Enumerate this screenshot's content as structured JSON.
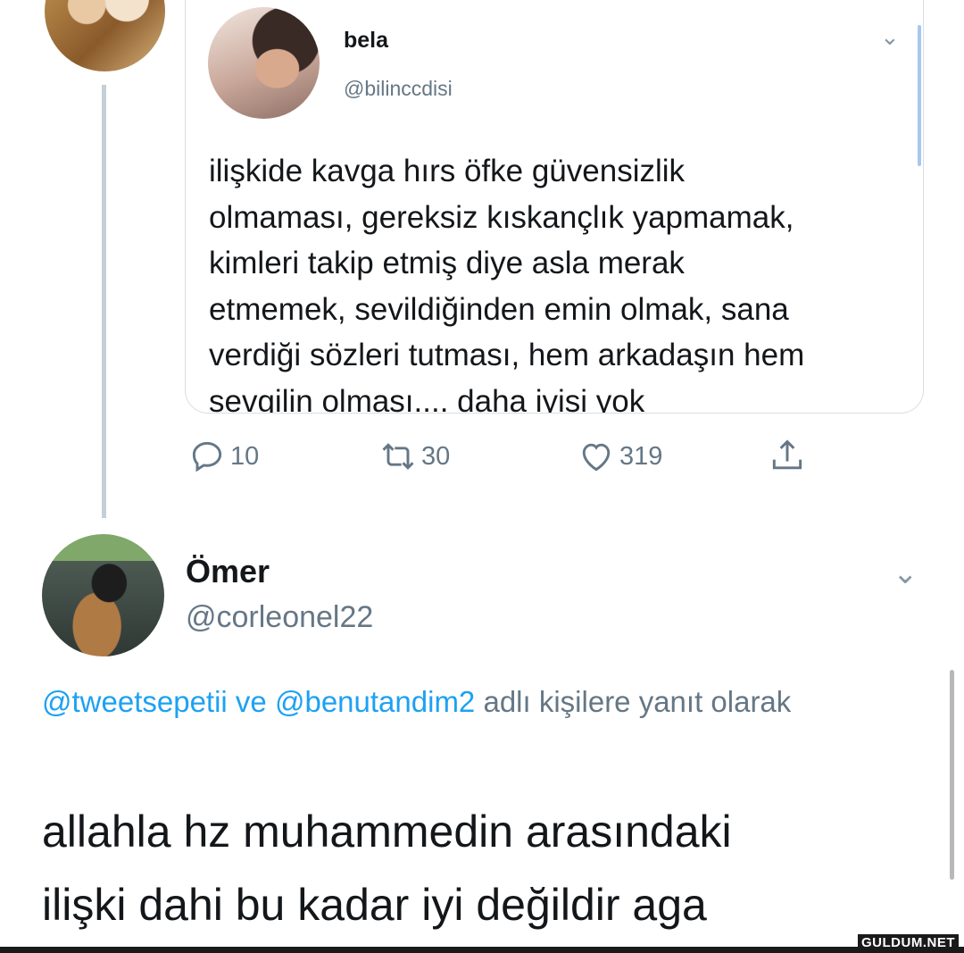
{
  "quoted_tweet": {
    "author_name": "bela",
    "author_handle": "@bilinccdisi",
    "text": "ilişkide kavga hırs öfke güvensizlik\nolmaması, gereksiz kıskançlık yapmamak,\nkimleri takip etmiş diye asla merak\netmemek, sevildiğinden emin olmak, sana\nverdiği sözleri tutması, hem arkadaşın hem\nsevgilin olması.... daha iyisi yok",
    "chevron_icon": "chevron-down-icon"
  },
  "actions": {
    "replies": "10",
    "retweets": "30",
    "likes": "319",
    "icons": [
      "reply-icon",
      "retweet-icon",
      "like-icon",
      "share-icon"
    ]
  },
  "reply_tweet": {
    "author_name": "Ömer",
    "author_handle": "@corleonel22",
    "reply_to_mention_1": "@tweetsepetii",
    "reply_to_connector": " ve ",
    "reply_to_mention_2": "@benutandim2",
    "reply_to_suffix": " adlı kişilere yanıt olarak",
    "text": "allahla hz muhammedin arasındaki\nilişki dahi bu kadar iyi değildir aga"
  },
  "watermark": "GULDUM.NET",
  "colors": {
    "link": "#1da1f2",
    "secondary": "#657786",
    "thread_line": "#c4cfd6"
  }
}
